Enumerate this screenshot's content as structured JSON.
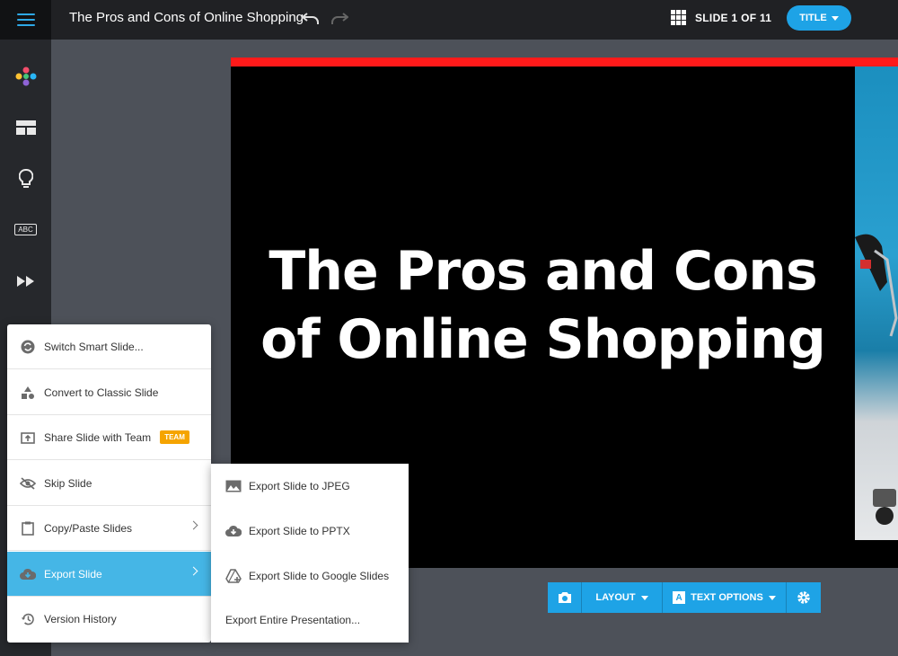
{
  "header": {
    "doc_title": "The Pros and Cons of Online Shopping",
    "slide_counter": "SLIDE 1 OF 11",
    "title_button": "TITLE"
  },
  "sidebar": {
    "items": [
      {
        "icon": "palette-icon"
      },
      {
        "icon": "layout-icon"
      },
      {
        "icon": "lightbulb-icon"
      },
      {
        "icon": "abc-icon",
        "label": "ABC"
      },
      {
        "icon": "fast-forward-icon"
      }
    ]
  },
  "slide": {
    "title_line1": "The Pros and Cons",
    "title_line2": "of Online Shopping",
    "accent_color": "#ff1a1a"
  },
  "toolbar": {
    "layout_label": "LAYOUT",
    "text_options_label": "TEXT OPTIONS",
    "text_icon_label": "A"
  },
  "context_menu": {
    "items": [
      {
        "label": "Switch Smart Slide...",
        "icon": "switch-icon"
      },
      {
        "label": "Convert to Classic Slide",
        "icon": "shapes-icon"
      },
      {
        "label": "Share Slide with Team",
        "icon": "share-icon",
        "badge": "TEAM"
      },
      {
        "label": "Skip Slide",
        "icon": "eye-off-icon"
      },
      {
        "label": "Copy/Paste Slides",
        "icon": "clipboard-icon"
      },
      {
        "label": "Export Slide",
        "icon": "cloud-download-icon"
      },
      {
        "label": "Version History",
        "icon": "history-icon"
      }
    ]
  },
  "export_submenu": {
    "items": [
      {
        "label": "Export Slide to JPEG",
        "icon": "image-icon"
      },
      {
        "label": "Export Slide to PPTX",
        "icon": "cloud-download-icon"
      },
      {
        "label": "Export Slide to Google Slides",
        "icon": "google-drive-icon"
      },
      {
        "label": "Export Entire Presentation..."
      }
    ]
  },
  "colors": {
    "accent": "#1ea3e6",
    "menu_active": "#45b6e6",
    "badge": "#f5a400"
  }
}
